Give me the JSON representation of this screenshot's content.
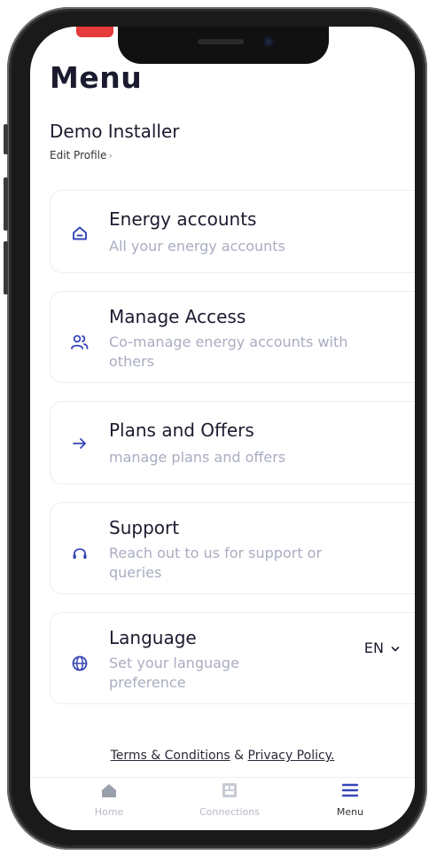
{
  "header": {
    "title": "Menu"
  },
  "profile": {
    "name": "Demo Installer",
    "edit_label": "Edit Profile",
    "edit_chevron": "›"
  },
  "menu": {
    "energy": {
      "title": "Energy accounts",
      "desc": "All your energy accounts",
      "icon": "home-outline-icon"
    },
    "access": {
      "title": "Manage Access",
      "desc": "Co-manage energy accounts with others",
      "icon": "users-icon"
    },
    "plans": {
      "title": "Plans and Offers",
      "desc": "manage plans and offers",
      "icon": "arrow-right-icon"
    },
    "support": {
      "title": "Support",
      "desc": "Reach out to us for support or queries",
      "icon": "headset-icon"
    },
    "language": {
      "title": "Language",
      "desc": "Set your language preference",
      "icon": "globe-icon",
      "selected": "EN"
    }
  },
  "footer": {
    "terms": "Terms & Conditions",
    "and": " & ",
    "privacy": "Privacy Policy."
  },
  "tabs": [
    {
      "label": "Home",
      "icon": "home-icon",
      "active": false
    },
    {
      "label": "Connections",
      "icon": "connections-icon",
      "active": false
    },
    {
      "label": "Menu",
      "icon": "menu-icon",
      "active": true
    }
  ],
  "colors": {
    "accent": "#3546b6",
    "title": "#1b1b2f",
    "muted": "#a9adc0",
    "status_red": "#e53b3b"
  }
}
